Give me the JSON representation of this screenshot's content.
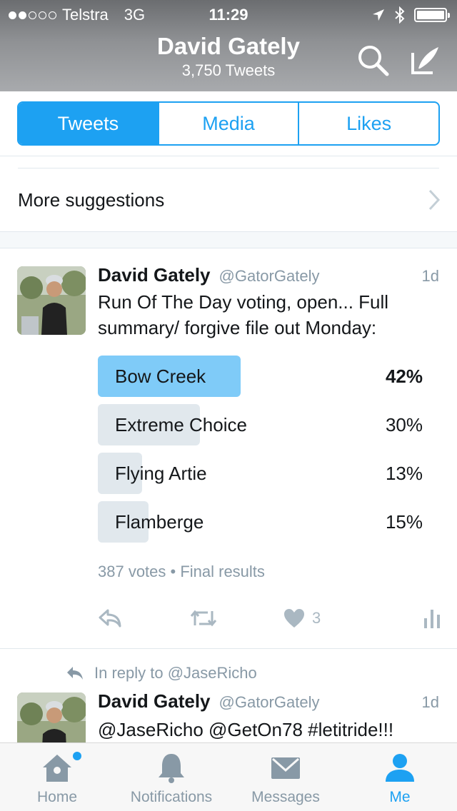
{
  "status_bar": {
    "carrier": "Telstra",
    "network": "3G",
    "time": "11:29"
  },
  "profile": {
    "name": "David Gately",
    "tweets_count": "3,750 Tweets"
  },
  "tabs": [
    {
      "label": "Tweets",
      "active": true
    },
    {
      "label": "Media",
      "active": false
    },
    {
      "label": "Likes",
      "active": false
    }
  ],
  "more_suggestions": "More suggestions",
  "tweet1": {
    "name": "David Gately",
    "handle": "@GatorGately",
    "time": "1d",
    "text": "Run Of The Day voting, open... Full summary/ forgive file out Monday:",
    "poll": [
      {
        "label": "Bow Creek",
        "percent": 42,
        "percent_text": "42%",
        "winner": true
      },
      {
        "label": "Extreme Choice",
        "percent": 30,
        "percent_text": "30%",
        "winner": false
      },
      {
        "label": "Flying Artie",
        "percent": 13,
        "percent_text": "13%",
        "winner": false
      },
      {
        "label": "Flamberge",
        "percent": 15,
        "percent_text": "15%",
        "winner": false
      }
    ],
    "poll_meta": "387 votes • Final results",
    "likes": "3"
  },
  "tweet2": {
    "reply_context": "In reply to @JaseRicho",
    "name": "David Gately",
    "handle": "@GatorGately",
    "time": "1d",
    "text": "@JaseRicho @GetOn78 #letitride!!!"
  },
  "tabbar": [
    {
      "label": "Home",
      "icon": "home-icon",
      "active": false
    },
    {
      "label": "Notifications",
      "icon": "bell-icon",
      "active": false
    },
    {
      "label": "Messages",
      "icon": "envelope-icon",
      "active": false
    },
    {
      "label": "Me",
      "icon": "person-icon",
      "active": true
    }
  ],
  "colors": {
    "accent": "#1da1f2",
    "poll_winner": "#7fcbf8",
    "poll_other": "#e1e8ed",
    "muted": "#8899a6"
  }
}
